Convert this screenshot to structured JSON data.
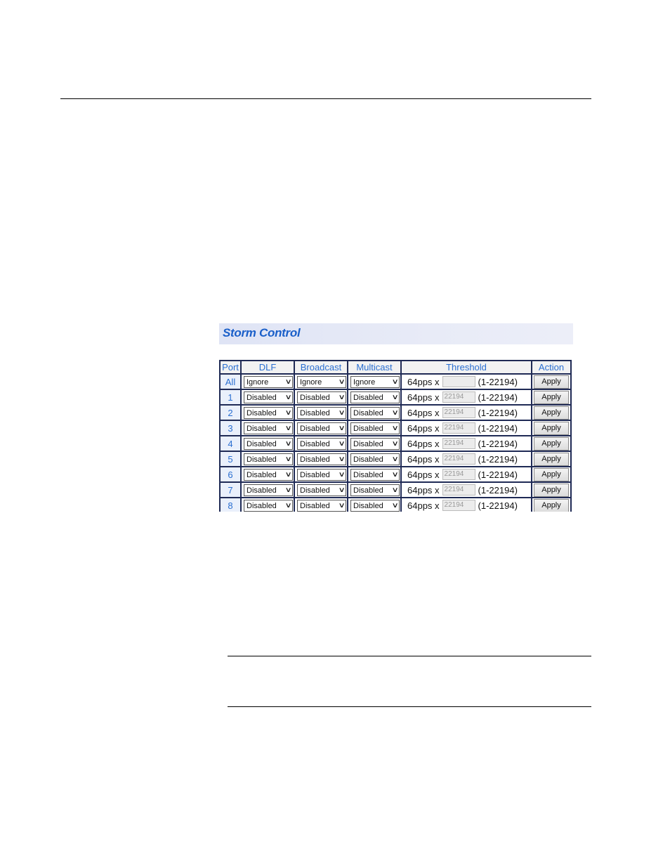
{
  "panel": {
    "title": "Storm Control"
  },
  "table": {
    "headers": {
      "port": "Port",
      "dlf": "DLF",
      "broadcast": "Broadcast",
      "multicast": "Multicast",
      "threshold": "Threshold",
      "action": "Action"
    },
    "rows": [
      {
        "port": "All",
        "dlf": "Ignore",
        "broadcast": "Ignore",
        "multicast": "Ignore",
        "unit": "64pps x",
        "threshold": "",
        "range": "(1-22194)",
        "action": "Apply"
      },
      {
        "port": "1",
        "dlf": "Disabled",
        "broadcast": "Disabled",
        "multicast": "Disabled",
        "unit": "64pps x",
        "threshold": "22194",
        "range": "(1-22194)",
        "action": "Apply"
      },
      {
        "port": "2",
        "dlf": "Disabled",
        "broadcast": "Disabled",
        "multicast": "Disabled",
        "unit": "64pps x",
        "threshold": "22194",
        "range": "(1-22194)",
        "action": "Apply"
      },
      {
        "port": "3",
        "dlf": "Disabled",
        "broadcast": "Disabled",
        "multicast": "Disabled",
        "unit": "64pps x",
        "threshold": "22194",
        "range": "(1-22194)",
        "action": "Apply"
      },
      {
        "port": "4",
        "dlf": "Disabled",
        "broadcast": "Disabled",
        "multicast": "Disabled",
        "unit": "64pps x",
        "threshold": "22194",
        "range": "(1-22194)",
        "action": "Apply"
      },
      {
        "port": "5",
        "dlf": "Disabled",
        "broadcast": "Disabled",
        "multicast": "Disabled",
        "unit": "64pps x",
        "threshold": "22194",
        "range": "(1-22194)",
        "action": "Apply"
      },
      {
        "port": "6",
        "dlf": "Disabled",
        "broadcast": "Disabled",
        "multicast": "Disabled",
        "unit": "64pps x",
        "threshold": "22194",
        "range": "(1-22194)",
        "action": "Apply"
      },
      {
        "port": "7",
        "dlf": "Disabled",
        "broadcast": "Disabled",
        "multicast": "Disabled",
        "unit": "64pps x",
        "threshold": "22194",
        "range": "(1-22194)",
        "action": "Apply"
      },
      {
        "port": "8",
        "dlf": "Disabled",
        "broadcast": "Disabled",
        "multicast": "Disabled",
        "unit": "64pps x",
        "threshold": "22194",
        "range": "(1-22194)",
        "action": "Apply"
      }
    ]
  },
  "icons": {
    "dropdown": "chevron-down-icon"
  },
  "colors": {
    "title_text": "#1a5fc9",
    "header_text": "#2a6fd1",
    "border": "#1f2a55"
  }
}
